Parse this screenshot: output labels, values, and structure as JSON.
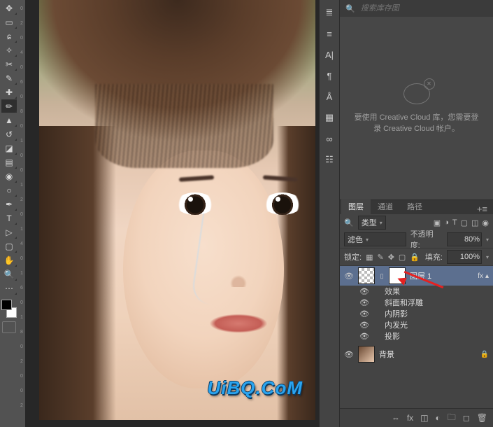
{
  "tools": [
    {
      "name": "move-tool",
      "glyph": "✥"
    },
    {
      "name": "marquee-tool",
      "glyph": "▭"
    },
    {
      "name": "lasso-tool",
      "glyph": "ɕ"
    },
    {
      "name": "magic-wand-tool",
      "glyph": "✧"
    },
    {
      "name": "crop-tool",
      "glyph": "✂"
    },
    {
      "name": "eyedropper-tool",
      "glyph": "✎"
    },
    {
      "name": "healing-brush-tool",
      "glyph": "✚"
    },
    {
      "name": "brush-tool",
      "glyph": "✏",
      "selected": true
    },
    {
      "name": "clone-stamp-tool",
      "glyph": "▲"
    },
    {
      "name": "history-brush-tool",
      "glyph": "↺"
    },
    {
      "name": "eraser-tool",
      "glyph": "◪"
    },
    {
      "name": "gradient-tool",
      "glyph": "▤"
    },
    {
      "name": "blur-tool",
      "glyph": "◉"
    },
    {
      "name": "dodge-tool",
      "glyph": "○"
    },
    {
      "name": "pen-tool",
      "glyph": "✒"
    },
    {
      "name": "type-tool",
      "glyph": "T"
    },
    {
      "name": "path-select-tool",
      "glyph": "▷"
    },
    {
      "name": "shape-tool",
      "glyph": "▢"
    },
    {
      "name": "hand-tool",
      "glyph": "✋"
    },
    {
      "name": "zoom-tool",
      "glyph": "🔍"
    },
    {
      "name": "more-tools",
      "glyph": "⋯"
    }
  ],
  "numbers": [
    "0",
    "2",
    "0",
    "4",
    "0",
    "6",
    "0",
    "8",
    "0",
    "1",
    "0",
    "0",
    "1",
    "2",
    "0",
    "1",
    "4",
    "0",
    "1",
    "6",
    "0",
    "1",
    "8",
    "0",
    "2",
    "0",
    "0",
    "2"
  ],
  "cc": {
    "search_placeholder": "搜索库存图",
    "message": "要使用 Creative Cloud 库，您需要登录 Creative Cloud 帐户。"
  },
  "dock_icons": [
    {
      "name": "history-icon",
      "glyph": "≣"
    },
    {
      "name": "actions-icon",
      "glyph": "≡"
    },
    {
      "name": "character-icon",
      "glyph": "A|"
    },
    {
      "name": "paragraph-icon",
      "glyph": "¶"
    },
    {
      "name": "glyphs-icon",
      "glyph": "Å"
    },
    {
      "name": "properties-icon",
      "glyph": "▦"
    },
    {
      "name": "info-icon",
      "glyph": "∞"
    },
    {
      "name": "adjustments-icon",
      "glyph": "☷"
    }
  ],
  "layers_panel": {
    "tabs": [
      {
        "label": "图层",
        "active": true
      },
      {
        "label": "通道",
        "active": false
      },
      {
        "label": "路径",
        "active": false
      }
    ],
    "filter_label": "类型",
    "filter_icons": [
      "▣",
      "◑",
      "T",
      "▢",
      "◫",
      "◉"
    ],
    "blend_mode": "滤色",
    "opacity_label": "不透明度:",
    "opacity_value": "80%",
    "lock_label": "锁定:",
    "fill_label": "填充:",
    "fill_value": "100%",
    "layers": [
      {
        "name": "图层 1",
        "selected": true,
        "has_mask": true,
        "fx_badge": "fx",
        "effects_header": "效果",
        "effects": [
          "斜面和浮雕",
          "内阴影",
          "内发光",
          "投影"
        ]
      },
      {
        "name": "背景",
        "locked": true
      }
    ],
    "footer_icons": [
      {
        "name": "link-layers-icon",
        "glyph": "⇔"
      },
      {
        "name": "layer-style-icon",
        "glyph": "fx"
      },
      {
        "name": "layer-mask-icon",
        "glyph": "◫"
      },
      {
        "name": "adjustment-layer-icon",
        "glyph": "◐"
      },
      {
        "name": "group-icon",
        "glyph": "🗀"
      },
      {
        "name": "new-layer-icon",
        "glyph": "◻"
      },
      {
        "name": "trash-icon",
        "glyph": "🗑"
      }
    ]
  },
  "watermark": "UiBQ.CoM"
}
